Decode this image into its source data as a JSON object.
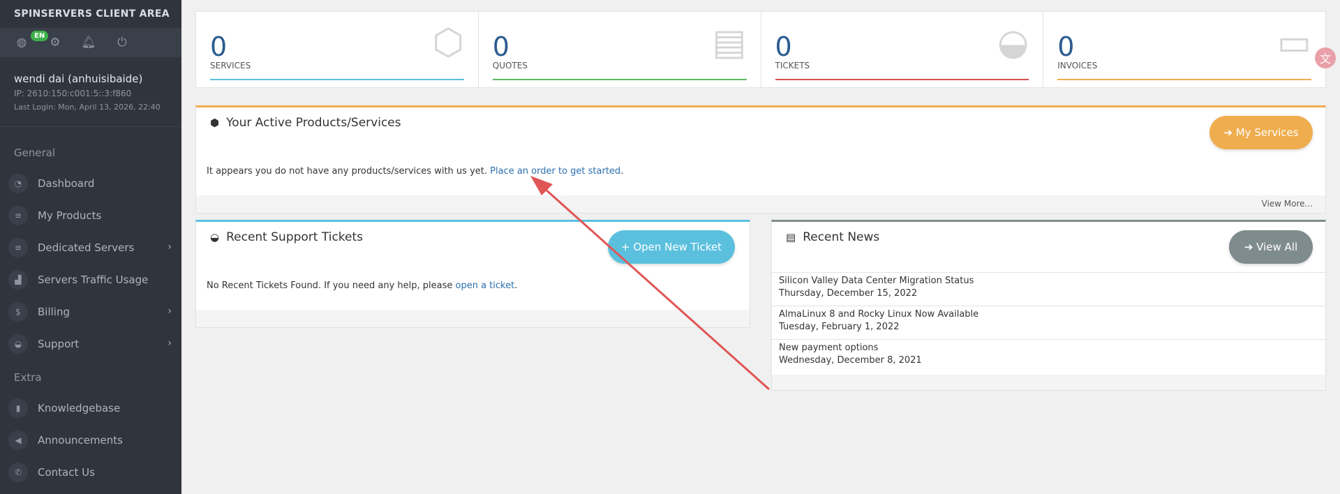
{
  "brand": "SPINSERVERS CLIENT AREA",
  "lang_badge": "EN",
  "user": {
    "name": "wendi dai (anhuisibaide)",
    "ip": "IP: 2610:150:c001:5::3:f860",
    "last_login": "Last Login: Mon, April 13, 2026, 22:40"
  },
  "nav": {
    "general_title": "General",
    "general": [
      {
        "label": "Dashboard",
        "icon": "dashboard-icon",
        "glyph": "◔",
        "chevron": ""
      },
      {
        "label": "My Products",
        "icon": "list-icon",
        "glyph": "≡",
        "chevron": ""
      },
      {
        "label": "Dedicated Servers",
        "icon": "server-icon",
        "glyph": "≡",
        "chevron": "›"
      },
      {
        "label": "Servers Traffic Usage",
        "icon": "chart-icon",
        "glyph": "▟",
        "chevron": ""
      },
      {
        "label": "Billing",
        "icon": "dollar-icon",
        "glyph": "$",
        "chevron": "›"
      },
      {
        "label": "Support",
        "icon": "comments-icon",
        "glyph": "◒",
        "chevron": "›"
      }
    ],
    "extra_title": "Extra",
    "extra": [
      {
        "label": "Knowledgebase",
        "icon": "book-icon",
        "glyph": "▮",
        "chevron": ""
      },
      {
        "label": "Announcements",
        "icon": "bullhorn-icon",
        "glyph": "◀",
        "chevron": ""
      },
      {
        "label": "Contact Us",
        "icon": "phone-icon",
        "glyph": "✆",
        "chevron": ""
      }
    ]
  },
  "stats": [
    {
      "num": "0",
      "label": "SERVICES",
      "color": "#5bc0de",
      "icon": "cube-icon",
      "glyph": "⬡"
    },
    {
      "num": "0",
      "label": "QUOTES",
      "color": "#5cb85c",
      "icon": "file-icon",
      "glyph": "▤"
    },
    {
      "num": "0",
      "label": "TICKETS",
      "color": "#d9534f",
      "icon": "comments-icon",
      "glyph": "◒"
    },
    {
      "num": "0",
      "label": "INVOICES",
      "color": "#f0ad4e",
      "icon": "credit-card-icon",
      "glyph": "▭"
    }
  ],
  "products": {
    "title": "Your Active Products/Services",
    "button": "➔ My Services",
    "text": "It appears you do not have any products/services with us yet.",
    "link": "Place an order to get started",
    "period": ".",
    "view_more": "View More..."
  },
  "tickets": {
    "title": "Recent Support Tickets",
    "button": "+ Open New Ticket",
    "text": "No Recent Tickets Found. If you need any help, please",
    "link": "open a ticket",
    "period": "."
  },
  "news": {
    "title": "Recent News",
    "button": "➔ View All",
    "items": [
      {
        "title": "Silicon Valley Data Center Migration Status",
        "date": "Thursday, December 15, 2022"
      },
      {
        "title": "AlmaLinux 8 and Rocky Linux Now Available",
        "date": "Tuesday, February 1, 2022"
      },
      {
        "title": "New payment options",
        "date": "Wednesday, December 8, 2021"
      }
    ]
  },
  "colors": {
    "products_accent": "#f0ad4e",
    "tickets_accent": "#5bc0de",
    "news_accent": "#7f8c8d",
    "orange_button": "#f0ad4e",
    "blue_button": "#5bc0de",
    "gray_button": "#7f8c8d"
  }
}
